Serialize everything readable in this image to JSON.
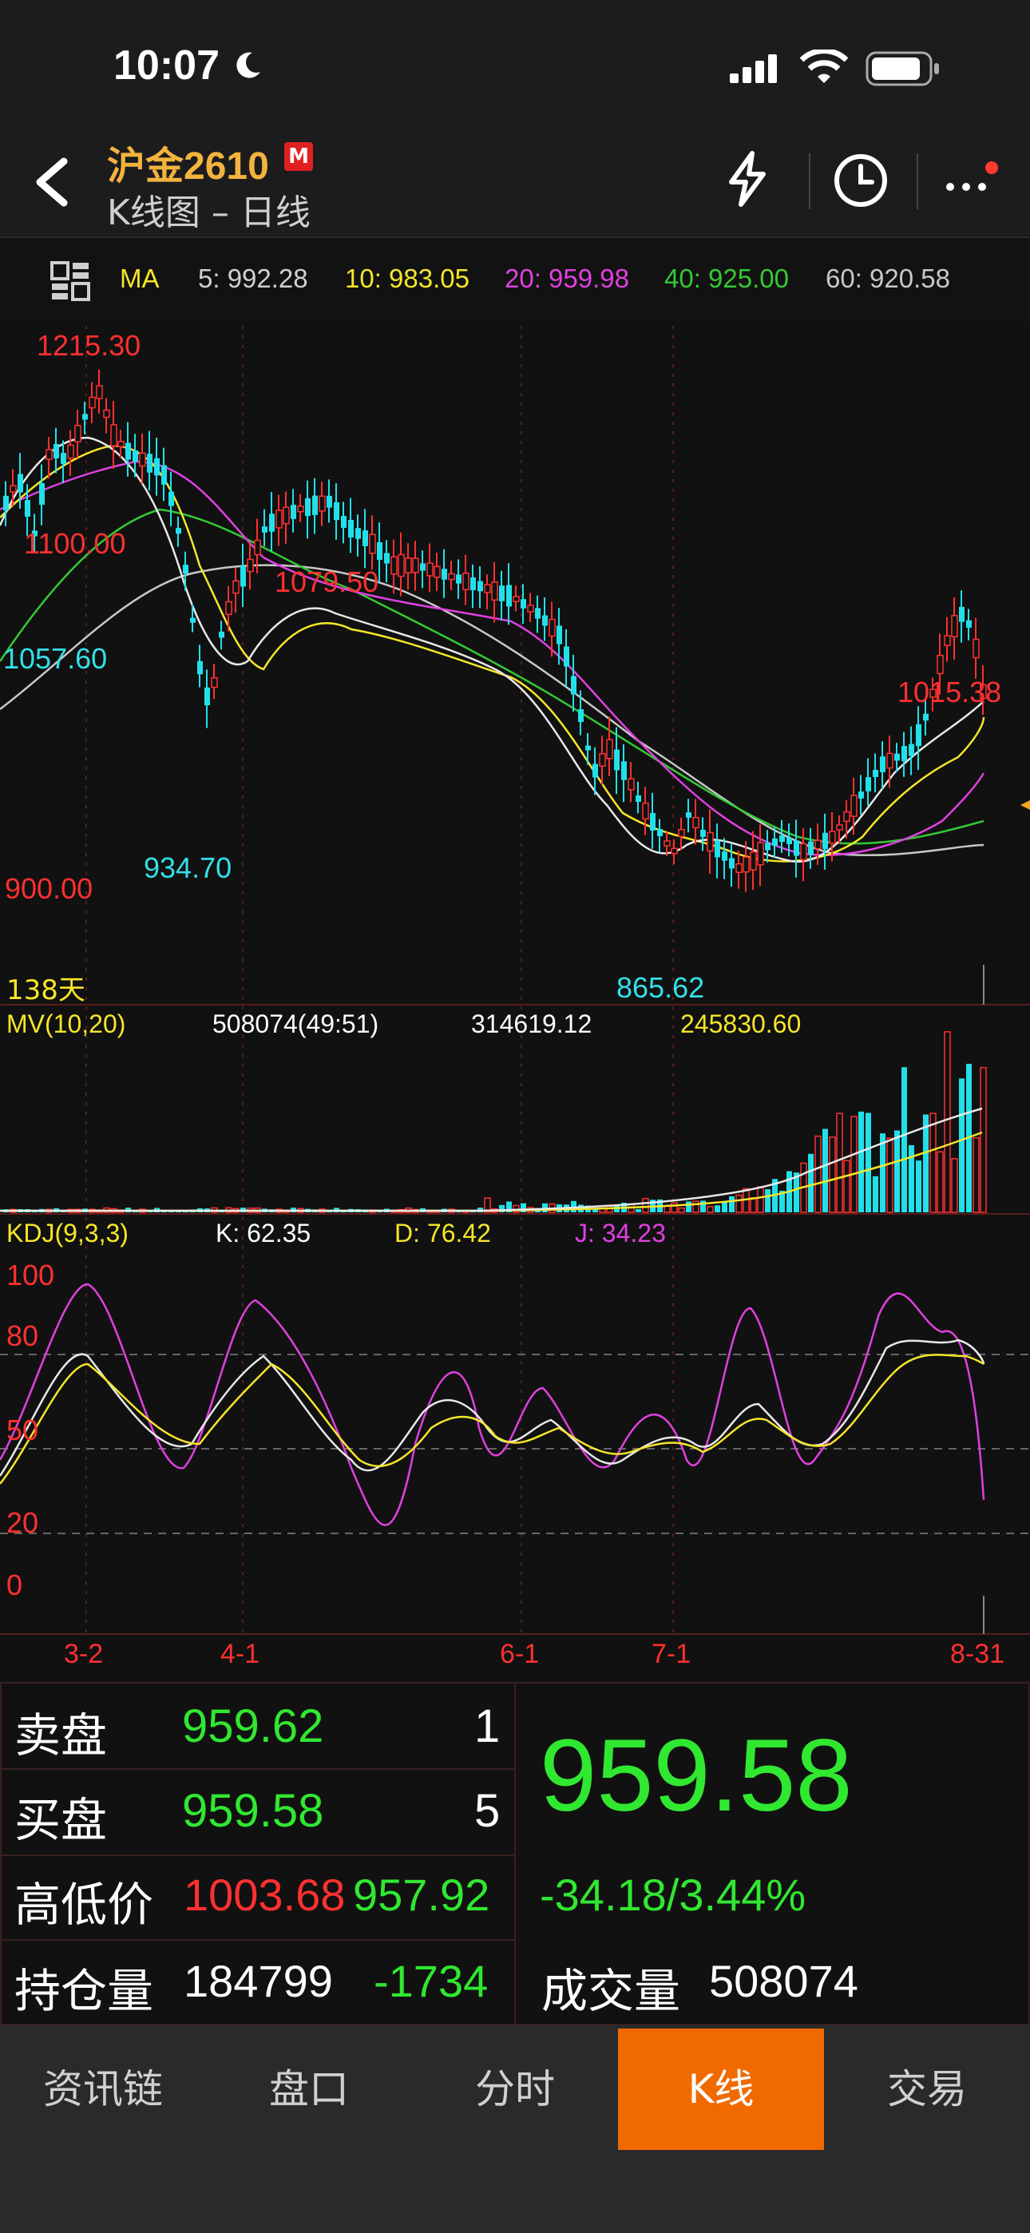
{
  "status_bar": {
    "time": "10:07"
  },
  "header": {
    "title": "沪金2610",
    "badge": "M",
    "subtitle": "K线图 – 日线"
  },
  "ma_bar": {
    "label": "MA",
    "ma5": "5: 992.28",
    "ma10": "10: 983.05",
    "ma20": "20: 959.98",
    "ma40": "40: 925.00",
    "ma60": "60: 920.58",
    "colors": {
      "ma5": "#d0d0d0",
      "ma10": "#f5e62a",
      "ma20": "#e040e0",
      "ma40": "#34c934",
      "ma60": "#c8c8c8"
    }
  },
  "price_panel": {
    "labels": {
      "high_label": "1215.30",
      "level_1100": "1100.00",
      "level_1057": "1057.60",
      "peak_mid": "1079.50",
      "low_mid": "934.70",
      "level_900": "900.00",
      "recent_high": "1015.38",
      "low_recent": "865.62",
      "days": "138天"
    }
  },
  "volume_panel": {
    "title": "MV(10,20)",
    "vol": "508074(49:51)",
    "mv10": "314619.12",
    "mv20": "245830.60"
  },
  "kdj_panel": {
    "title": "KDJ(9,3,3)",
    "k": "K: 62.35",
    "d": "D: 76.42",
    "j": "J: 34.23",
    "levels": [
      "100",
      "80",
      "50",
      "20",
      "0"
    ]
  },
  "x_axis": {
    "dates": [
      "3-2",
      "4-1",
      "6-1",
      "7-1",
      "8-31"
    ]
  },
  "quote": {
    "sell_label": "卖盘",
    "sell_price": "959.62",
    "sell_qty": "1",
    "buy_label": "买盘",
    "buy_price": "959.58",
    "buy_qty": "5",
    "hilo_label": "高低价",
    "high": "1003.68",
    "low": "957.92",
    "oi_label": "持仓量",
    "oi": "184799",
    "oi_change": "-1734",
    "last": "959.58",
    "change": "-34.18/3.44%",
    "vol_label": "成交量",
    "volume": "508074"
  },
  "tabs": [
    "资讯链",
    "盘口",
    "分时",
    "K线",
    "交易"
  ],
  "active_tab": "K线"
}
